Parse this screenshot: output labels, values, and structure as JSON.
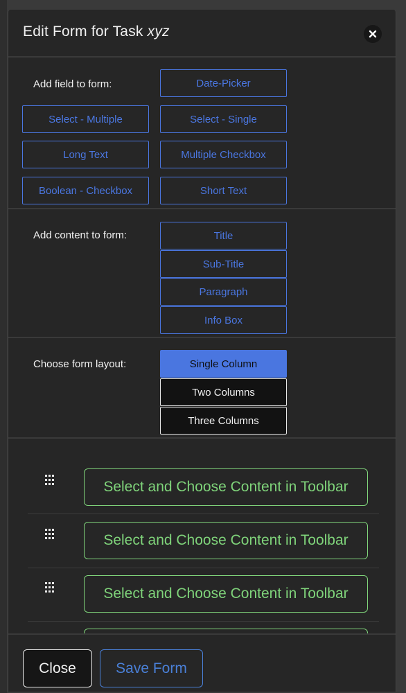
{
  "modal": {
    "title_prefix": "Edit Form for Task ",
    "title_task": "xyz"
  },
  "fields_section": {
    "label": "Add field to form:",
    "buttons": [
      "Date-Picker",
      "Select - Multiple",
      "Select - Single",
      "Long Text",
      "Multiple Checkbox",
      "Boolean - Checkbox",
      "Short Text"
    ]
  },
  "content_section": {
    "label": "Add content to form:",
    "buttons": [
      "Title",
      "Sub-Title",
      "Paragraph",
      "Info Box"
    ]
  },
  "layout_section": {
    "label": "Choose form layout:",
    "options": [
      "Single Column",
      "Two Columns",
      "Three Columns"
    ],
    "selected": "Single Column"
  },
  "canvas": {
    "placeholder": "Select and Choose Content in Toolbar"
  },
  "footer": {
    "close_label": "Close",
    "save_label": "Save Form"
  },
  "colors": {
    "accent_blue": "#4a76e0",
    "placeholder_green": "#7fd37a",
    "background": "#262626"
  }
}
